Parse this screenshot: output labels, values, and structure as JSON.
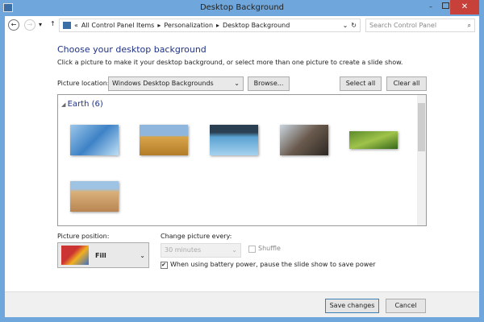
{
  "window": {
    "title": "Desktop Background"
  },
  "nav": {
    "breadcrumb": [
      "All Control Panel Items",
      "Personalization",
      "Desktop Background"
    ],
    "search_placeholder": "Search Control Panel"
  },
  "main": {
    "heading": "Choose your desktop background",
    "instructions": "Click a picture to make it your desktop background, or select more than one picture to create a slide show.",
    "picture_location_label": "Picture location:",
    "picture_location_value": "Windows Desktop Backgrounds",
    "browse": "Browse...",
    "select_all": "Select all",
    "clear_all": "Clear all",
    "group": "Earth (6)",
    "position_label": "Picture position:",
    "position_value": "Fill",
    "change_label": "Change picture every:",
    "change_value": "30 minutes",
    "shuffle": "Shuffle",
    "battery": "When using battery power, pause the slide show to save power",
    "save": "Save changes",
    "cancel": "Cancel"
  },
  "thumbnails": [
    {
      "name": "blue-ice",
      "bg": "linear-gradient(135deg,#9cc7ea,#3e82c6,#bfe0f5)"
    },
    {
      "name": "desert-field",
      "bg": "linear-gradient(#8fb7de 35%,#d8a44a 40%,#b27c28)"
    },
    {
      "name": "blue-water",
      "bg": "linear-gradient(#2a3f52 25%,#5aa2d2 40%,#a5d2ee)"
    },
    {
      "name": "rocky-coast",
      "bg": "linear-gradient(135deg,#c9d6e0,#6a5a4d,#2d2823)"
    },
    {
      "name": "green-hill",
      "bg": "linear-gradient(160deg,#5c8b2c,#9fc34a,#35661a)"
    },
    {
      "name": "sand-dune",
      "bg": "linear-gradient(#9fc3e2 25%,#d9b07a 35%,#b98653)"
    }
  ]
}
